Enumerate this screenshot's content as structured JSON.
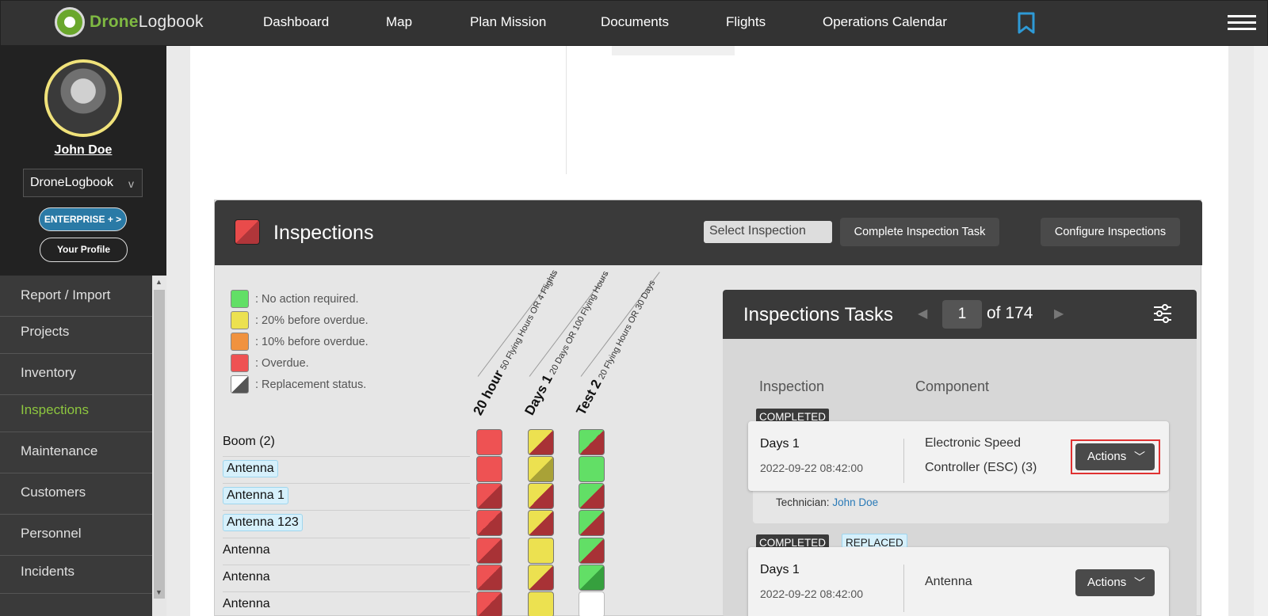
{
  "app": {
    "logo_brand": "Drone",
    "logo_rest": "Logbook",
    "nav": [
      "Dashboard",
      "Map",
      "Plan Mission",
      "Documents",
      "Flights",
      "Operations Calendar"
    ]
  },
  "sidebar": {
    "user_name": "John Doe",
    "org_selected": "DroneLogbook",
    "org_caret": "v",
    "enterprise_label": "ENTERPRISE + >",
    "profile_label": "Your Profile",
    "menu": [
      "Report / Import",
      "Projects",
      "Inventory",
      "Inspections",
      "Maintenance",
      "Customers",
      "Personnel",
      "Incidents"
    ],
    "active_item": "Inspections"
  },
  "inspections": {
    "title": "Inspections",
    "select_placeholder": "Select Inspection",
    "complete_btn": "Complete Inspection Task",
    "configure_btn": "Configure Inspections",
    "legend": [
      {
        "color": "#62df66",
        "text": ": No action required."
      },
      {
        "color": "#ece150",
        "text": ": 20% before overdue."
      },
      {
        "color": "#f0923f",
        "text": ": 10% before overdue."
      },
      {
        "color": "#ee5253",
        "text": ": Overdue."
      },
      {
        "color": "gray-split",
        "text": ": Replacement status."
      }
    ],
    "columns": [
      {
        "name": "20 hour",
        "sub": "50 Flying Hours OR 4 Flights"
      },
      {
        "name": "Days 1",
        "sub": "20 Days OR 100 Flying Hours"
      },
      {
        "name": "Test 2",
        "sub": "20 Flying Hours OR 30 Days"
      }
    ],
    "rows": [
      {
        "label": "Boom (2)",
        "tag": false,
        "cells": [
          "red",
          "yel-red",
          "grn-red"
        ]
      },
      {
        "label": "Antenna",
        "tag": true,
        "cells": [
          "red",
          "yel-olive",
          "green"
        ]
      },
      {
        "label": "Antenna 1",
        "tag": true,
        "cells": [
          "red-split",
          "yel-red",
          "grn-red"
        ]
      },
      {
        "label": "Antenna 123",
        "tag": true,
        "cells": [
          "red-split",
          "yel-red",
          "grn-red"
        ]
      },
      {
        "label": "Antenna",
        "tag": false,
        "cells": [
          "red-split",
          "yellow",
          "grn-red"
        ]
      },
      {
        "label": "Antenna",
        "tag": false,
        "cells": [
          "red-split",
          "yel-red",
          "grn-dk"
        ]
      },
      {
        "label": "Antenna",
        "tag": false,
        "cells": [
          "red-split",
          "yellow",
          "white"
        ]
      }
    ]
  },
  "tasks": {
    "title": "Inspections Tasks",
    "page": "1",
    "page_of": "of 174",
    "headers": {
      "inspection": "Inspection",
      "component": "Component"
    },
    "items": [
      {
        "badges": [
          "COMPLETED"
        ],
        "name": "Days 1",
        "date": "2022-09-22 08:42:00",
        "component": "Electronic Speed Controller (ESC) (3)",
        "actions": "Actions",
        "tech_label": "Technician:",
        "tech_name": "John Doe"
      },
      {
        "badges": [
          "COMPLETED",
          "REPLACED"
        ],
        "name": "Days 1",
        "date": "2022-09-22 08:42:00",
        "component": "Antenna",
        "actions": "Actions"
      }
    ]
  }
}
